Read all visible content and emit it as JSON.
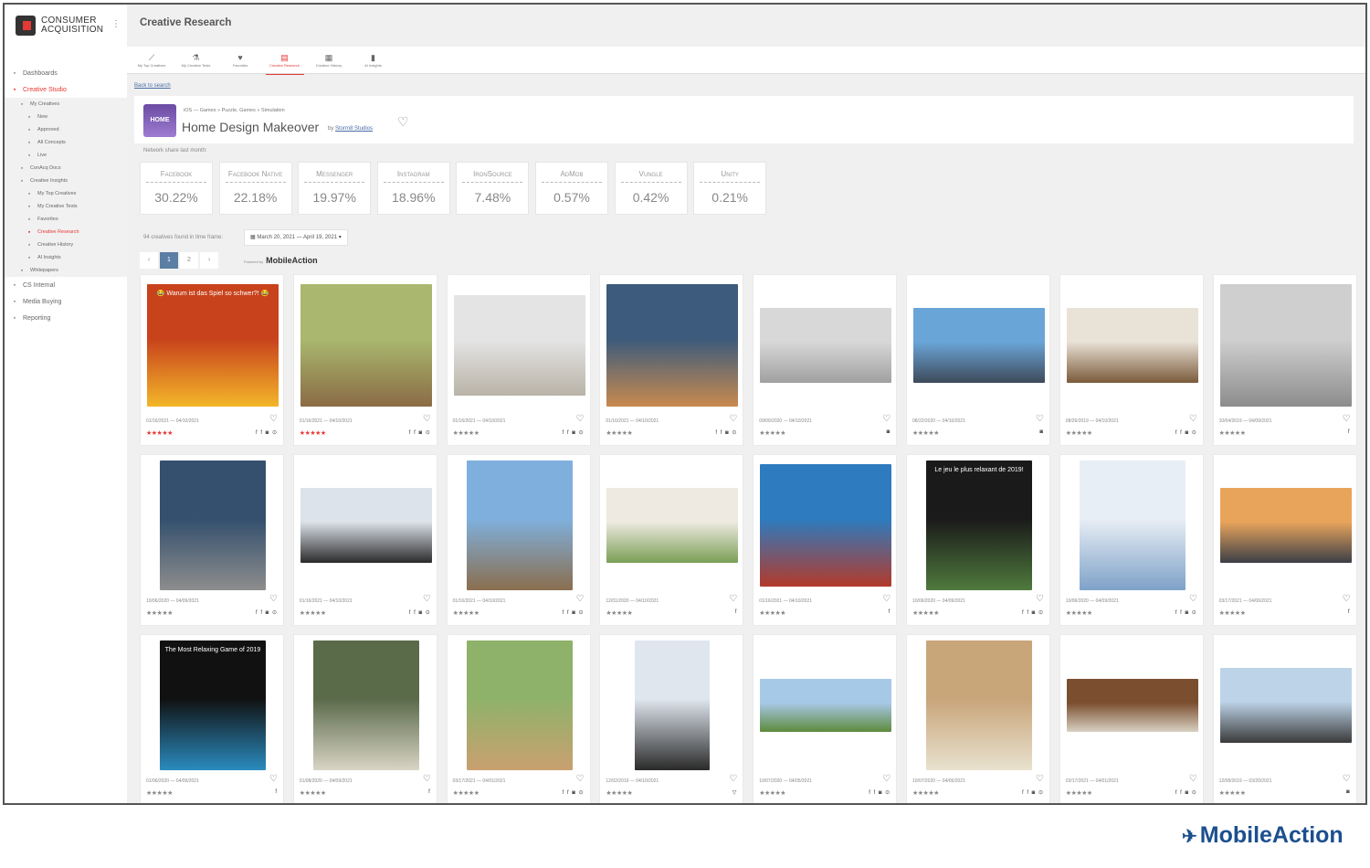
{
  "brand": {
    "name_line1": "CONSUMER",
    "name_line2": "ACQUISITION"
  },
  "header": {
    "title": "Creative Research"
  },
  "sidebar": {
    "items": [
      {
        "label": "Dashboards",
        "icon": "monitor-icon",
        "level": 1
      },
      {
        "label": "Creative Studio",
        "icon": "drop-icon",
        "level": 1,
        "active": true
      },
      {
        "label": "My Creatives",
        "icon": "folder-icon",
        "level": 2
      },
      {
        "label": "New",
        "icon": "image-icon",
        "level": 3
      },
      {
        "label": "Approved",
        "icon": "check-icon",
        "level": 3
      },
      {
        "label": "All Concepts",
        "icon": "list-icon",
        "level": 3
      },
      {
        "label": "Live",
        "icon": "facebook-icon",
        "level": 3
      },
      {
        "label": "ConAcq Docs",
        "icon": "doc-icon",
        "level": 2
      },
      {
        "label": "Creative Insights",
        "icon": "chart-icon",
        "level": 2
      },
      {
        "label": "My Top Creatives",
        "icon": "trend-icon",
        "level": 3
      },
      {
        "label": "My Creative Tests",
        "icon": "flask-icon",
        "level": 3
      },
      {
        "label": "Favorites",
        "icon": "heart-icon",
        "level": 3
      },
      {
        "label": "Creative Research",
        "icon": "research-icon",
        "level": 3,
        "active": true
      },
      {
        "label": "Creative History",
        "icon": "calendar-icon",
        "level": 3
      },
      {
        "label": "AI Insights",
        "icon": "bars-icon",
        "level": 3
      },
      {
        "label": "Whitepapers",
        "icon": "doc-icon",
        "level": 2
      },
      {
        "label": "CS Internal",
        "icon": "drop-icon",
        "level": 1
      },
      {
        "label": "Media Buying",
        "icon": "megaphone-icon",
        "level": 1
      },
      {
        "label": "Reporting",
        "icon": "monitor-icon",
        "level": 1
      }
    ]
  },
  "topnav": [
    {
      "label": "My Top Creatives",
      "icon": "trend-icon"
    },
    {
      "label": "My Creative Tests",
      "icon": "flask-icon"
    },
    {
      "label": "Favorites",
      "icon": "heart-icon"
    },
    {
      "label": "Creative Research",
      "icon": "research-icon",
      "active": true
    },
    {
      "label": "Creative History",
      "icon": "calendar-icon"
    },
    {
      "label": "AI Insights",
      "icon": "bars-icon"
    }
  ],
  "back_link": "Back to search",
  "app": {
    "category": "iOS — Games » Puzzle, Games » Simulation",
    "title": "Home Design Makeover",
    "by": "by",
    "developer": "Storm8 Studios",
    "icon_text": "HOME"
  },
  "share_label": "Network share last month:",
  "shares": [
    {
      "name": "Facebook",
      "value": "30.22%"
    },
    {
      "name": "Facebook Native",
      "value": "22.18%"
    },
    {
      "name": "Messenger",
      "value": "19.97%"
    },
    {
      "name": "Instagram",
      "value": "18.96%"
    },
    {
      "name": "IronSource",
      "value": "7.48%"
    },
    {
      "name": "AdMob",
      "value": "0.57%"
    },
    {
      "name": "Vungle",
      "value": "0.42%"
    },
    {
      "name": "Unity",
      "value": "0.21%"
    }
  ],
  "found_text": "94 creatives found in time frame:",
  "date_range": "March 20, 2021 — April 19, 2021",
  "pagination": {
    "prev": "‹",
    "pages": [
      "1",
      "2"
    ],
    "next": "›",
    "current": "1"
  },
  "powered_by": {
    "label": "Powered by",
    "name": "MobileAction"
  },
  "creatives": [
    {
      "date": "01/16/2021 — 04/10/2021",
      "stars": "red",
      "nets": "f f ◙ ⊙",
      "overlay": "😂 Warum ist das Spiel so schwer?! 😂",
      "colors": [
        "#c8431c",
        "#f3b629"
      ]
    },
    {
      "date": "01/16/2021 — 04/10/2021",
      "stars": "red",
      "nets": "f f ◙ ⊙",
      "overlay": "",
      "colors": [
        "#a9b86e",
        "#8a6b45"
      ]
    },
    {
      "date": "01/16/2021 — 04/10/2021",
      "stars": "gray",
      "nets": "f f ◙ ⊙",
      "overlay": "",
      "colors": [
        "#e4e4e4",
        "#b9b3a8"
      ]
    },
    {
      "date": "01/16/2021 — 04/10/2021",
      "stars": "gray",
      "nets": "f f ◙ ⊙",
      "overlay": "",
      "colors": [
        "#3d5b7c",
        "#c88a4e"
      ]
    },
    {
      "date": "09/09/2020 — 04/10/2021",
      "stars": "gray",
      "nets": "◙",
      "overlay": "",
      "colors": [
        "#d8d8d8",
        "#a0a0a0"
      ]
    },
    {
      "date": "08/22/2020 — 04/10/2021",
      "stars": "gray",
      "nets": "◙",
      "overlay": "",
      "colors": [
        "#6aa5d8",
        "#3e4a5a"
      ]
    },
    {
      "date": "08/26/2019 — 04/10/2021",
      "stars": "gray",
      "nets": "f f ◙ ⊙",
      "overlay": "",
      "colors": [
        "#e9e2d6",
        "#7a5a3a"
      ]
    },
    {
      "date": "10/04/2019 — 04/09/2021",
      "stars": "gray",
      "nets": "f",
      "overlay": "",
      "colors": [
        "#cfcfcf",
        "#8c8c8c"
      ]
    },
    {
      "date": "10/06/2020 — 04/09/2021",
      "stars": "gray",
      "nets": "f f ◙ ⊙",
      "overlay": "",
      "colors": [
        "#34506e",
        "#8d8d8d"
      ]
    },
    {
      "date": "01/16/2021 — 04/10/2021",
      "stars": "gray",
      "nets": "f f ◙ ⊙",
      "overlay": "",
      "colors": [
        "#dde3ea",
        "#2b2b2b"
      ]
    },
    {
      "date": "01/16/2021 — 04/10/2021",
      "stars": "gray",
      "nets": "f f ◙ ⊙",
      "overlay": "",
      "colors": [
        "#7fb0dd",
        "#8a6e4e"
      ]
    },
    {
      "date": "12/01/2020 — 04/10/2021",
      "stars": "gray",
      "nets": "f",
      "overlay": "",
      "colors": [
        "#eeeae1",
        "#7a9f55"
      ]
    },
    {
      "date": "01/16/2021 — 04/10/2021",
      "stars": "gray",
      "nets": "f",
      "overlay": "",
      "colors": [
        "#2e7bbf",
        "#b33a2a"
      ]
    },
    {
      "date": "10/06/2020 — 04/09/2021",
      "stars": "gray",
      "nets": "f f ◙ ⊙",
      "overlay": "Le jeu le plus relaxant de 2019!",
      "colors": [
        "#1a1a1a",
        "#4f7a3d"
      ]
    },
    {
      "date": "10/06/2020 — 04/09/2021",
      "stars": "gray",
      "nets": "f f ◙ ⊙",
      "overlay": "",
      "colors": [
        "#e8eef5",
        "#7ea2c8"
      ]
    },
    {
      "date": "03/17/2021 — 04/06/2021",
      "stars": "gray",
      "nets": "f",
      "overlay": "",
      "colors": [
        "#e9a45c",
        "#3b3f47"
      ]
    },
    {
      "date": "01/06/2020 — 04/09/2021",
      "stars": "gray",
      "nets": "f",
      "overlay": "The Most Relaxing Game of 2019",
      "colors": [
        "#111111",
        "#2a8bbf"
      ]
    },
    {
      "date": "01/08/2020 — 04/09/2021",
      "stars": "gray",
      "nets": "f",
      "overlay": "",
      "colors": [
        "#5a6b4a",
        "#d9d4c5"
      ]
    },
    {
      "date": "03/17/2021 — 04/01/2021",
      "stars": "gray",
      "nets": "f f ◙ ⊙",
      "overlay": "",
      "colors": [
        "#8fb26a",
        "#c9a070"
      ]
    },
    {
      "date": "12/02/2019 — 04/10/2021",
      "stars": "gray",
      "nets": "▽",
      "overlay": "",
      "colors": [
        "#dfe6ee",
        "#2a2a2a"
      ]
    },
    {
      "date": "10/07/2020 — 04/05/2021",
      "stars": "gray",
      "nets": "f f ◙ ⊙",
      "overlay": "",
      "colors": [
        "#a7c9e8",
        "#5e8a3c"
      ]
    },
    {
      "date": "10/07/2020 — 04/05/2021",
      "stars": "gray",
      "nets": "f f ◙ ⊙",
      "overlay": "",
      "colors": [
        "#c9a57a",
        "#e8e2cf"
      ]
    },
    {
      "date": "03/17/2021 — 04/01/2021",
      "stars": "gray",
      "nets": "f f ◙ ⊙",
      "overlay": "",
      "colors": [
        "#7a4e2e",
        "#d8d0c2"
      ]
    },
    {
      "date": "12/08/2019 — 03/20/2021",
      "stars": "gray",
      "nets": "◙",
      "overlay": "",
      "colors": [
        "#bdd3e8",
        "#3a3a3a"
      ]
    }
  ],
  "stars_text": "★★★★★",
  "heart_glyph": "♡",
  "footer_brand": "MobileAction"
}
